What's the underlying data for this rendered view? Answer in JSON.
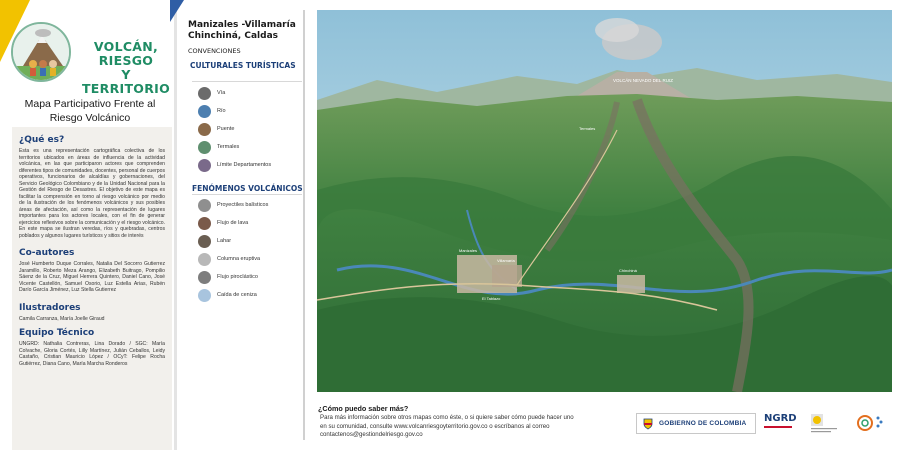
{
  "brand": {
    "logo_title_line1": "VOLCÁN, RIESGO",
    "logo_title_line2": "Y TERRITORIO"
  },
  "document": {
    "title_line1": "Mapa Participativo Frente al",
    "title_line2": "Riesgo Volcánico"
  },
  "info": {
    "que_es": {
      "heading": "¿Qué es?",
      "text": "Esta es una representación cartográfica colectiva de los territorios ubicados en áreas de influencia de la actividad volcánica, en las que participaron actores que comprenden diferentes tipos de comunidades, docentes, personal de cuerpos operativos, funcionarios de alcaldías y gobernaciones, del Servicio Geológico Colombiano y de la Unidad Nacional para la Gestión del Riesgo de Desastres. El objetivo de este mapa es facilitar la comprensión en torno al riesgo volcánico por medio de la ilustración de los fenómenos volcánicos y sus posibles áreas de afectación, así como la representación de lugares importantes para los actores locales, con el fin de generar ejercicios reflexivos sobre la comunicación y el riesgo volcánico. En este mapa se ilustran veredas, ríos y quebradas, centros poblados y algunos lugares turísticos y sitios de interés"
    },
    "coautores": {
      "heading": "Co-autores",
      "text": "José Humberto Duque Corrales, Natalia Del Socorro Gutierrez Jaramillo, Roberto Meza Arango, Elizabeth Buitrago, Pompilio Sáenz de la Cruz, Miguel Herrera Quintero, Daniel Cano, José Vicente Castellón, Samuel Osorio, Luz Estella Arias, Rubén Darío García Jiménez, Luz Stella Gutierrez"
    },
    "ilustradores": {
      "heading": "Ilustradores",
      "text": "Camila Carranza, María Joelle Giraud"
    },
    "equipo": {
      "heading": "Equipo Técnico",
      "text": "UNGRD: Nathalia Contreras, Lina Dorado / SGC: María Colvache, Gloria Cortés, Lilly Martínez, Julián Ceballos, Leidy Castaño, Cristian Mauricio López / OCyT: Felipe Rocha Gutiérrez, Diana Cano, María Marcha Ronderos"
    }
  },
  "legend": {
    "location_line1": "Manizales -Villamaría",
    "location_line2": "Chinchiná, Caldas",
    "convenciones": "CONVENCIONES",
    "culturales_heading_line1": "CULTURALES TURÍSTICAS",
    "culturales_items": [
      {
        "label": "Vía",
        "icon": "road-icon",
        "color": "#6b6b6b"
      },
      {
        "label": "Río",
        "icon": "river-icon",
        "color": "#4d7fb0"
      },
      {
        "label": "Puente",
        "icon": "bridge-icon",
        "color": "#8a6a4a"
      },
      {
        "label": "Termales",
        "icon": "hot-springs-icon",
        "color": "#5f8f6f"
      },
      {
        "label": "Límite Departamentos",
        "icon": "boundary-icon",
        "color": "#7a6a8a"
      }
    ],
    "volcanicos_heading": "FENÓMENOS VOLCÁNICOS",
    "volcanicos_items": [
      {
        "label": "Proyectiles balísticos",
        "icon": "ballistic-icon",
        "color": "#8f8f8f"
      },
      {
        "label": "Flujo de lava",
        "icon": "lava-flow-icon",
        "color": "#7a5a4a"
      },
      {
        "label": "Lahar",
        "icon": "lahar-icon",
        "color": "#6a5e52"
      },
      {
        "label": "Columna eruptiva",
        "icon": "eruptive-column-icon",
        "color": "#b8b8b8"
      },
      {
        "label": "Flujo piroclástico",
        "icon": "pyroclastic-flow-icon",
        "color": "#7d7d7d"
      },
      {
        "label": "Caída de ceniza",
        "icon": "ash-fall-icon",
        "color": "#a8c4de"
      }
    ]
  },
  "map": {
    "volcano_label": "VOLCÁN NEVADO DEL RUIZ",
    "place_labels": [
      "Villamaría",
      "Chinchiná",
      "El Tablazo",
      "Manizales",
      "Termales"
    ]
  },
  "footer": {
    "question": "¿Cómo puedo saber más?",
    "text_line1": "Para más información sobre otros mapas como éste, o si quiere saber cómo puede hacer uno",
    "text_line2": "en su comunidad, consulte www.volcanriesgoyterritorio.gov.co o escríbanos al correo",
    "text_line3": "contactenos@gestiondelriesgo.gov.co",
    "gov_label": "GOBIERNO DE COLOMBIA",
    "ngrd_label": "NGRD"
  },
  "colors": {
    "accent_blue": "#1c3f78",
    "accent_green": "#1f8c64",
    "accent_yellow": "#f2c200",
    "map_green": "#3e7a3c",
    "sky": "#a9cde0"
  }
}
